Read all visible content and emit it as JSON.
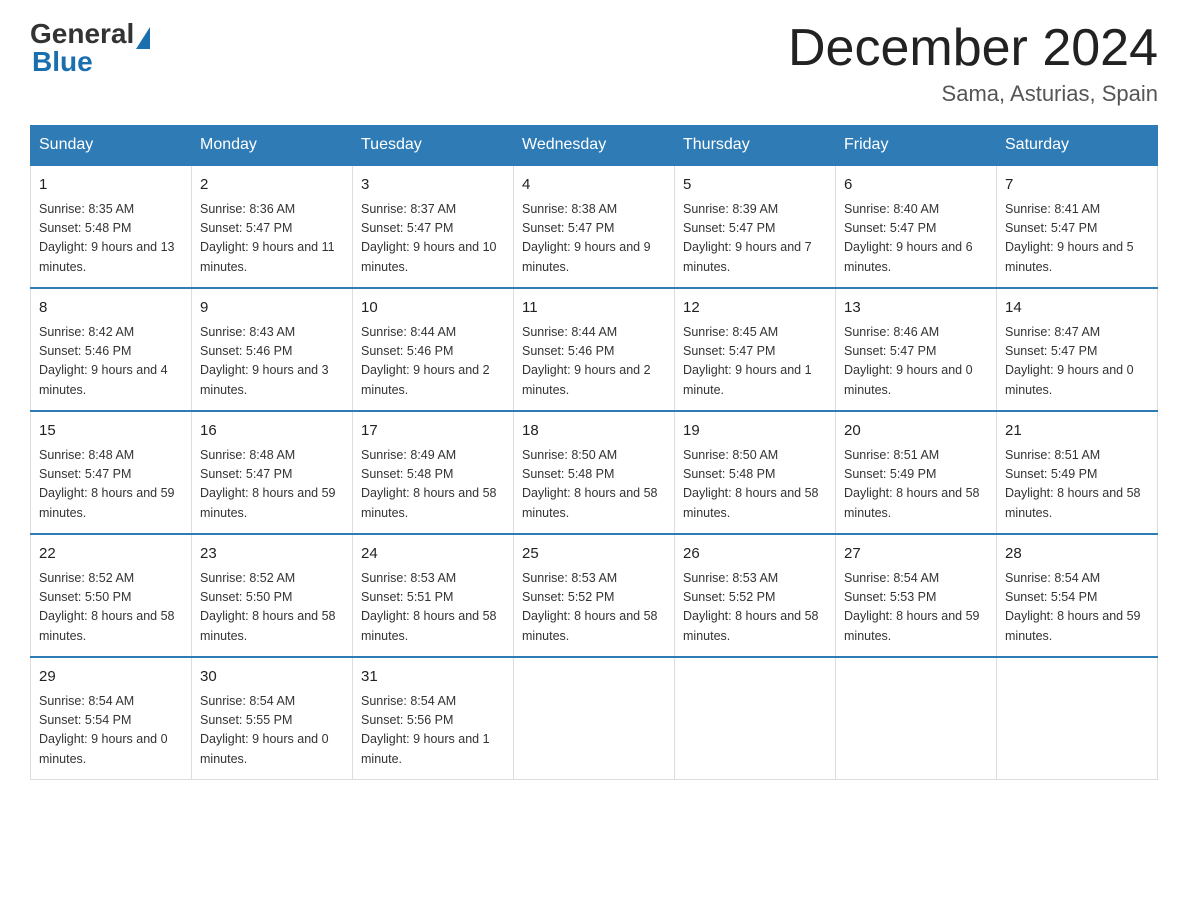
{
  "logo": {
    "general": "General",
    "blue": "Blue"
  },
  "header": {
    "title": "December 2024",
    "subtitle": "Sama, Asturias, Spain"
  },
  "weekdays": [
    "Sunday",
    "Monday",
    "Tuesday",
    "Wednesday",
    "Thursday",
    "Friday",
    "Saturday"
  ],
  "weeks": [
    [
      {
        "day": "1",
        "sunrise": "8:35 AM",
        "sunset": "5:48 PM",
        "daylight": "9 hours and 13 minutes."
      },
      {
        "day": "2",
        "sunrise": "8:36 AM",
        "sunset": "5:47 PM",
        "daylight": "9 hours and 11 minutes."
      },
      {
        "day": "3",
        "sunrise": "8:37 AM",
        "sunset": "5:47 PM",
        "daylight": "9 hours and 10 minutes."
      },
      {
        "day": "4",
        "sunrise": "8:38 AM",
        "sunset": "5:47 PM",
        "daylight": "9 hours and 9 minutes."
      },
      {
        "day": "5",
        "sunrise": "8:39 AM",
        "sunset": "5:47 PM",
        "daylight": "9 hours and 7 minutes."
      },
      {
        "day": "6",
        "sunrise": "8:40 AM",
        "sunset": "5:47 PM",
        "daylight": "9 hours and 6 minutes."
      },
      {
        "day": "7",
        "sunrise": "8:41 AM",
        "sunset": "5:47 PM",
        "daylight": "9 hours and 5 minutes."
      }
    ],
    [
      {
        "day": "8",
        "sunrise": "8:42 AM",
        "sunset": "5:46 PM",
        "daylight": "9 hours and 4 minutes."
      },
      {
        "day": "9",
        "sunrise": "8:43 AM",
        "sunset": "5:46 PM",
        "daylight": "9 hours and 3 minutes."
      },
      {
        "day": "10",
        "sunrise": "8:44 AM",
        "sunset": "5:46 PM",
        "daylight": "9 hours and 2 minutes."
      },
      {
        "day": "11",
        "sunrise": "8:44 AM",
        "sunset": "5:46 PM",
        "daylight": "9 hours and 2 minutes."
      },
      {
        "day": "12",
        "sunrise": "8:45 AM",
        "sunset": "5:47 PM",
        "daylight": "9 hours and 1 minute."
      },
      {
        "day": "13",
        "sunrise": "8:46 AM",
        "sunset": "5:47 PM",
        "daylight": "9 hours and 0 minutes."
      },
      {
        "day": "14",
        "sunrise": "8:47 AM",
        "sunset": "5:47 PM",
        "daylight": "9 hours and 0 minutes."
      }
    ],
    [
      {
        "day": "15",
        "sunrise": "8:48 AM",
        "sunset": "5:47 PM",
        "daylight": "8 hours and 59 minutes."
      },
      {
        "day": "16",
        "sunrise": "8:48 AM",
        "sunset": "5:47 PM",
        "daylight": "8 hours and 59 minutes."
      },
      {
        "day": "17",
        "sunrise": "8:49 AM",
        "sunset": "5:48 PM",
        "daylight": "8 hours and 58 minutes."
      },
      {
        "day": "18",
        "sunrise": "8:50 AM",
        "sunset": "5:48 PM",
        "daylight": "8 hours and 58 minutes."
      },
      {
        "day": "19",
        "sunrise": "8:50 AM",
        "sunset": "5:48 PM",
        "daylight": "8 hours and 58 minutes."
      },
      {
        "day": "20",
        "sunrise": "8:51 AM",
        "sunset": "5:49 PM",
        "daylight": "8 hours and 58 minutes."
      },
      {
        "day": "21",
        "sunrise": "8:51 AM",
        "sunset": "5:49 PM",
        "daylight": "8 hours and 58 minutes."
      }
    ],
    [
      {
        "day": "22",
        "sunrise": "8:52 AM",
        "sunset": "5:50 PM",
        "daylight": "8 hours and 58 minutes."
      },
      {
        "day": "23",
        "sunrise": "8:52 AM",
        "sunset": "5:50 PM",
        "daylight": "8 hours and 58 minutes."
      },
      {
        "day": "24",
        "sunrise": "8:53 AM",
        "sunset": "5:51 PM",
        "daylight": "8 hours and 58 minutes."
      },
      {
        "day": "25",
        "sunrise": "8:53 AM",
        "sunset": "5:52 PM",
        "daylight": "8 hours and 58 minutes."
      },
      {
        "day": "26",
        "sunrise": "8:53 AM",
        "sunset": "5:52 PM",
        "daylight": "8 hours and 58 minutes."
      },
      {
        "day": "27",
        "sunrise": "8:54 AM",
        "sunset": "5:53 PM",
        "daylight": "8 hours and 59 minutes."
      },
      {
        "day": "28",
        "sunrise": "8:54 AM",
        "sunset": "5:54 PM",
        "daylight": "8 hours and 59 minutes."
      }
    ],
    [
      {
        "day": "29",
        "sunrise": "8:54 AM",
        "sunset": "5:54 PM",
        "daylight": "9 hours and 0 minutes."
      },
      {
        "day": "30",
        "sunrise": "8:54 AM",
        "sunset": "5:55 PM",
        "daylight": "9 hours and 0 minutes."
      },
      {
        "day": "31",
        "sunrise": "8:54 AM",
        "sunset": "5:56 PM",
        "daylight": "9 hours and 1 minute."
      },
      null,
      null,
      null,
      null
    ]
  ]
}
